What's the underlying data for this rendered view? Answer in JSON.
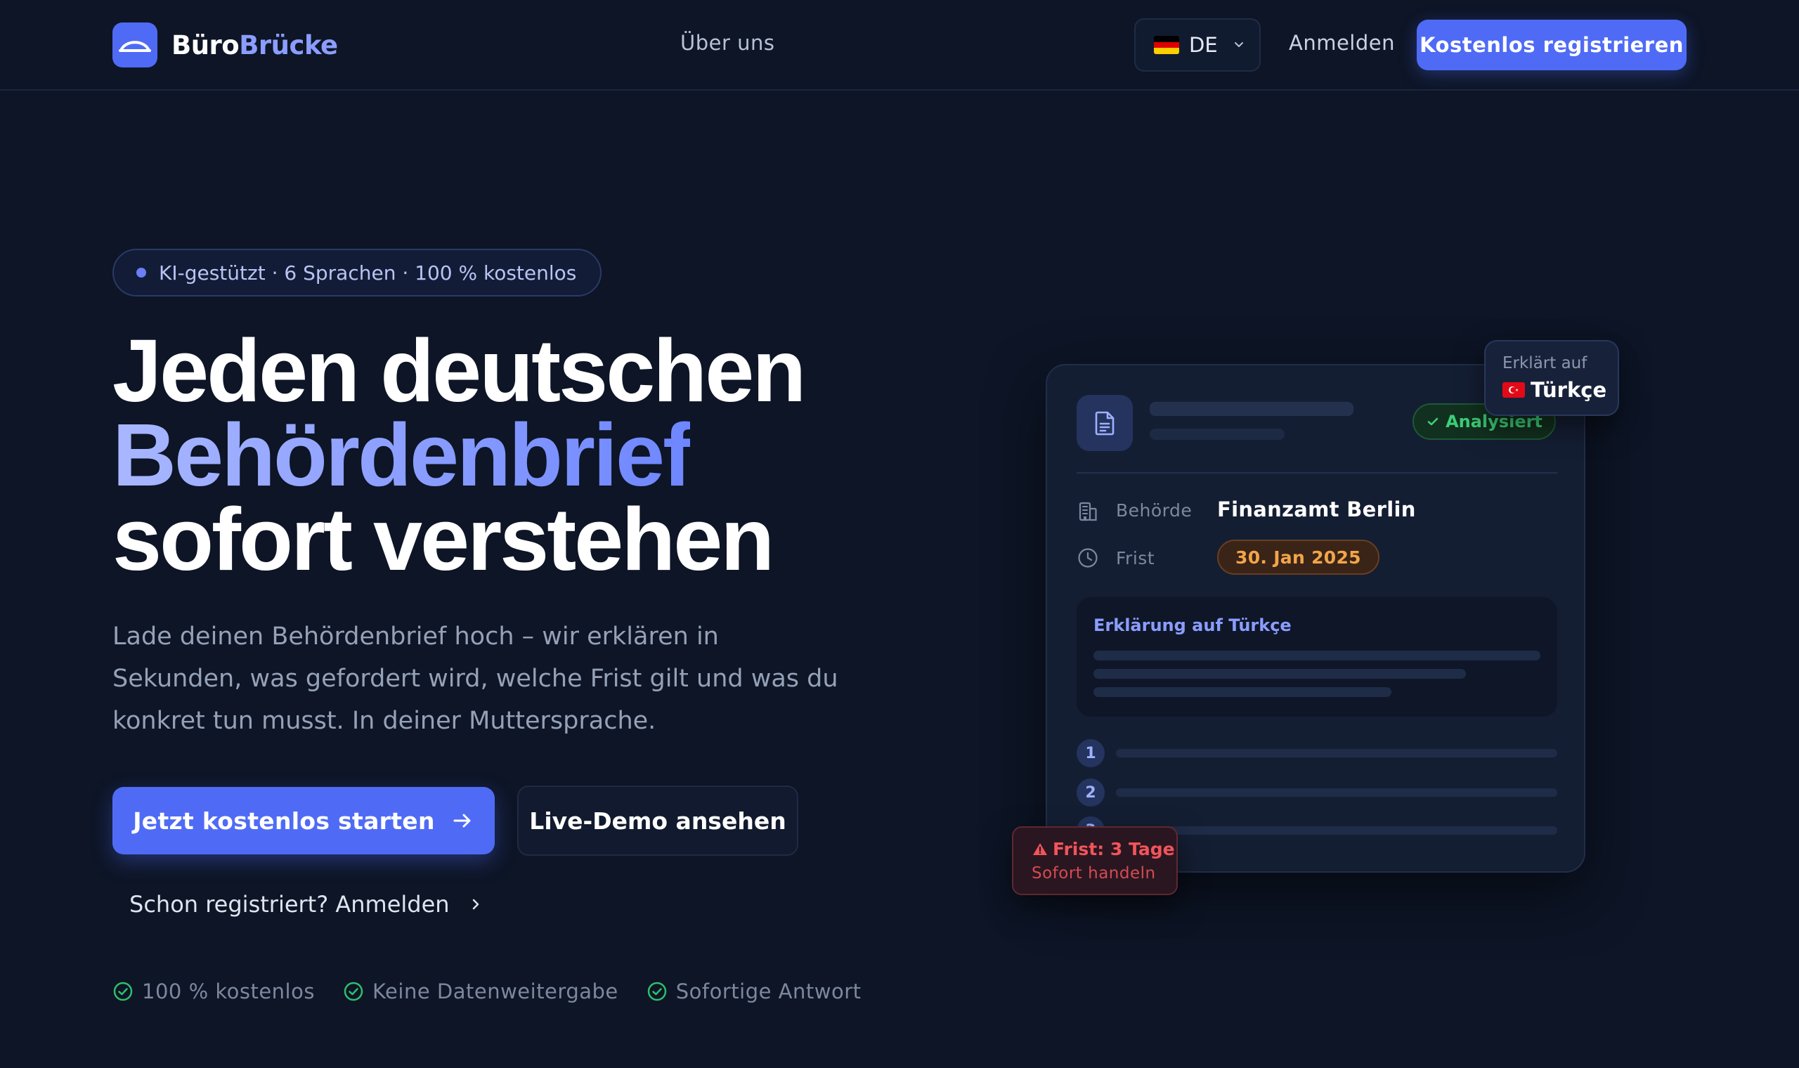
{
  "nav": {
    "brand_part1": "Büro",
    "brand_part2": "Brücke",
    "about_label": "Über uns",
    "language_code": "DE",
    "login_label": "Anmelden",
    "register_label": "Kostenlos registrieren"
  },
  "hero": {
    "badge": "KI-gestützt · 6 Sprachen · 100 % kostenlos",
    "headline_line1": "Jeden deutschen",
    "headline_line2": "Behördenbrief",
    "headline_line3": "sofort verstehen",
    "lead": "Lade deinen Behördenbrief hoch – wir erklären in Sekunden, was gefordert wird, welche Frist gilt und was du konkret tun musst. In deiner Muttersprache.",
    "cta_primary": "Jetzt kostenlos starten",
    "cta_secondary": "Live-Demo ansehen",
    "already_registered": "Schon registriert? Anmelden",
    "trust": [
      "100 % kostenlos",
      "Keine Datenweitergabe",
      "Sofortige Antwort"
    ]
  },
  "card": {
    "status": "Analysiert",
    "agency_label": "Behörde",
    "agency_value": "Finanzamt Berlin",
    "deadline_label": "Frist",
    "deadline_value": "30. Jan 2025",
    "explanation_title": "Erklärung auf Türkçe",
    "steps": [
      "1",
      "2",
      "3"
    ]
  },
  "floating": {
    "lang_label": "Erklärt auf",
    "lang_value": "Türkçe",
    "alert_title": "Frist: 3 Tage",
    "alert_sub": "Sofort handeln"
  },
  "colors": {
    "background": "#0d1526",
    "accent": "#4f6bf5",
    "success": "#3ccf78",
    "warning": "#f2a54a",
    "danger": "#f2545b"
  },
  "icons": {
    "logo": "bridge-icon",
    "language": "flag-germany-icon",
    "dropdown": "chevron-down-icon",
    "cta": "arrow-right-icon",
    "login_link": "chevron-right-icon",
    "trust": "check-circle-icon",
    "document": "document-icon",
    "agency": "building-icon",
    "deadline": "clock-icon",
    "alert": "warning-triangle-icon"
  }
}
